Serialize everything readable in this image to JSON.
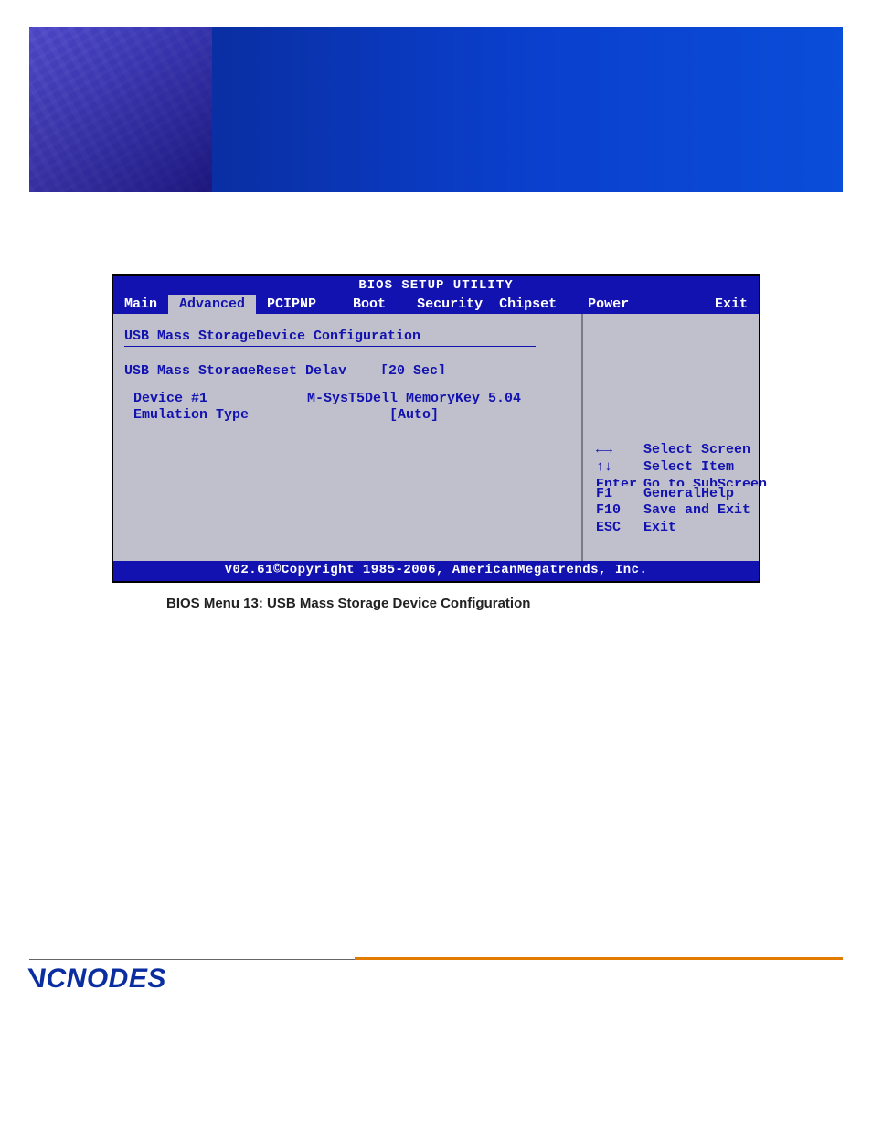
{
  "bios": {
    "title": "BIOS SETUP UTILITY",
    "tabs": [
      "Main",
      "Advanced",
      "PCIPNP",
      "Boot",
      "Security",
      "Chipset",
      "Power",
      "Exit"
    ],
    "active_tab_index": 1,
    "section_heading": "USB Mass StorageDevice Configuration",
    "cut_row": {
      "label": "USB Mass StorageReset Delay",
      "value": "[20 Sec]"
    },
    "device": {
      "row1_label": "Device #1",
      "row1_value": "M-SysT5Dell MemoryKey 5.04",
      "row2_label": "Emulation Type",
      "row2_value": "[Auto]"
    },
    "help": [
      {
        "key": "←→",
        "text": "Select Screen"
      },
      {
        "key": "↑↓",
        "text": "Select Item"
      },
      {
        "key_cut": "Enter",
        "text_cut": "Go to SubScreen"
      },
      {
        "key": "F1",
        "text": "GeneralHelp"
      },
      {
        "key": "F10",
        "text": "Save and Exit"
      },
      {
        "key": "ESC",
        "text": "Exit"
      }
    ],
    "footer": "V02.61©Copyright 1985-2006, AmericanMegatrends, Inc."
  },
  "caption": "BIOS Menu 13: USB Mass Storage Device Configuration",
  "brand": "ACNODES"
}
